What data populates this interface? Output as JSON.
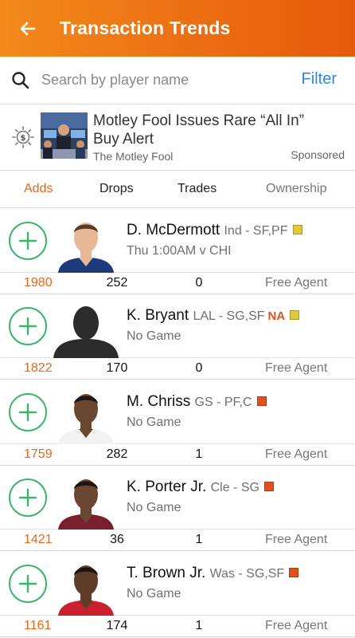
{
  "header": {
    "title": "Transaction Trends"
  },
  "search": {
    "placeholder": "Search by player name",
    "filter_label": "Filter"
  },
  "ad": {
    "title": "Motley Fool Issues Rare “All In” Buy Alert",
    "source": "The Motley Fool",
    "sponsored_label": "Sponsored"
  },
  "tabs": [
    {
      "label": "Adds",
      "active": true
    },
    {
      "label": "Drops",
      "active": false
    },
    {
      "label": "Trades",
      "active": false
    },
    {
      "label": "Ownership",
      "active": false
    }
  ],
  "players": [
    {
      "name": "D. McDermott",
      "team_pos": "Ind - SF,PF",
      "na": "",
      "game": "Thu 1:00AM v CHI",
      "note_color": "#e2c93a",
      "adds": "1980",
      "drops": "252",
      "trades": "0",
      "ownership": "Free Agent",
      "jersey": "#1d3a7a",
      "skin": "#e7b896",
      "hair": "#5a3a22"
    },
    {
      "name": "K. Bryant",
      "team_pos": "LAL - SG,SF",
      "na": "NA",
      "game": "No Game",
      "note_color": "#e2c93a",
      "adds": "1822",
      "drops": "170",
      "trades": "0",
      "ownership": "Free Agent",
      "jersey": "#2b2b2b",
      "skin": "#2b2b2b",
      "hair": "#2b2b2b"
    },
    {
      "name": "M. Chriss",
      "team_pos": "GS - PF,C",
      "na": "",
      "game": "No Game",
      "note_color": "#e0521b",
      "adds": "1759",
      "drops": "282",
      "trades": "1",
      "ownership": "Free Agent",
      "jersey": "#f2f2f2",
      "skin": "#6b4630",
      "hair": "#1d1512"
    },
    {
      "name": "K. Porter Jr.",
      "team_pos": "Cle - SG",
      "na": "",
      "game": "No Game",
      "note_color": "#e0521b",
      "adds": "1421",
      "drops": "36",
      "trades": "1",
      "ownership": "Free Agent",
      "jersey": "#7a1f2e",
      "skin": "#6b4630",
      "hair": "#1d1512"
    },
    {
      "name": "T. Brown Jr.",
      "team_pos": "Was - SG,SF",
      "na": "",
      "game": "No Game",
      "note_color": "#e0521b",
      "adds": "1161",
      "drops": "174",
      "trades": "1",
      "ownership": "Free Agent",
      "jersey": "#c8202f",
      "skin": "#5e3c28",
      "hair": "#1d1512"
    }
  ],
  "colors": {
    "header_start": "#f28a1b",
    "header_end": "#e65a0c",
    "accent": "#e8661a",
    "link": "#2f86e0",
    "add_green": "#3cb46a"
  }
}
